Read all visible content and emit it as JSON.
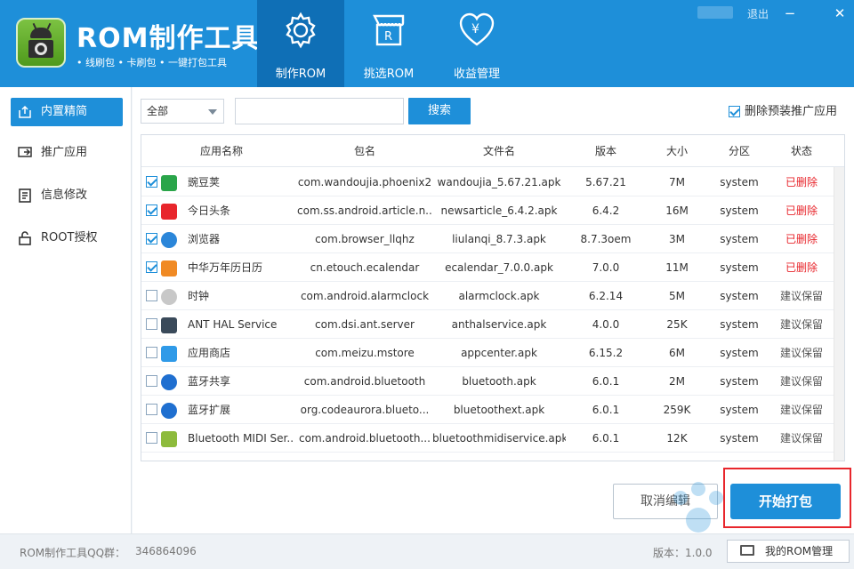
{
  "app": {
    "title": "ROM制作工具",
    "subtitle": "• 线刷包   • 卡刷包   • 一键打包工具",
    "logout": "退出"
  },
  "nav": {
    "tabs": [
      {
        "label": "制作ROM",
        "icon": "gear-icon"
      },
      {
        "label": "挑选ROM",
        "icon": "store-icon"
      },
      {
        "label": "收益管理",
        "icon": "heart-yen-icon"
      }
    ]
  },
  "sidebar": {
    "items": [
      {
        "label": "内置精简",
        "icon": "export-icon"
      },
      {
        "label": "推广应用",
        "icon": "install-icon"
      },
      {
        "label": "信息修改",
        "icon": "document-icon"
      },
      {
        "label": "ROOT授权",
        "icon": "lock-icon"
      }
    ]
  },
  "filter": {
    "select_value": "全部",
    "search_placeholder": "",
    "search_button": "搜索",
    "delete_preinstalled_label": "删除预装推广应用",
    "delete_preinstalled_checked": true
  },
  "table": {
    "columns": [
      "应用名称",
      "包名",
      "文件名",
      "版本",
      "大小",
      "分区",
      "状态"
    ],
    "rows": [
      {
        "checked": true,
        "icon": "wandoujia-icon",
        "name": "豌豆荚",
        "package": "com.wandoujia.phoenix2",
        "file": "wandoujia_5.67.21.apk",
        "version": "5.67.21",
        "size": "7M",
        "partition": "system",
        "status": "已删除"
      },
      {
        "checked": true,
        "icon": "toutiao-icon",
        "name": "今日头条",
        "package": "com.ss.android.article.n...",
        "file": "newsarticle_6.4.2.apk",
        "version": "6.4.2",
        "size": "16M",
        "partition": "system",
        "status": "已删除"
      },
      {
        "checked": true,
        "icon": "browser-icon",
        "name": "浏览器",
        "package": "com.browser_llqhz",
        "file": "liulanqi_8.7.3.apk",
        "version": "8.7.3oem",
        "size": "3M",
        "partition": "system",
        "status": "已删除"
      },
      {
        "checked": true,
        "icon": "calendar-icon",
        "name": "中华万年历日历",
        "package": "cn.etouch.ecalendar",
        "file": "ecalendar_7.0.0.apk",
        "version": "7.0.0",
        "size": "11M",
        "partition": "system",
        "status": "已删除"
      },
      {
        "checked": false,
        "icon": "clock-icon",
        "name": "时钟",
        "package": "com.android.alarmclock",
        "file": "alarmclock.apk",
        "version": "6.2.14",
        "size": "5M",
        "partition": "system",
        "status": "建议保留"
      },
      {
        "checked": false,
        "icon": "ant-hal-icon",
        "name": "ANT HAL Service",
        "package": "com.dsi.ant.server",
        "file": "anthalservice.apk",
        "version": "4.0.0",
        "size": "25K",
        "partition": "system",
        "status": "建议保留"
      },
      {
        "checked": false,
        "icon": "app-store-icon",
        "name": "应用商店",
        "package": "com.meizu.mstore",
        "file": "appcenter.apk",
        "version": "6.15.2",
        "size": "6M",
        "partition": "system",
        "status": "建议保留"
      },
      {
        "checked": false,
        "icon": "bluetooth-icon",
        "name": "蓝牙共享",
        "package": "com.android.bluetooth",
        "file": "bluetooth.apk",
        "version": "6.0.1",
        "size": "2M",
        "partition": "system",
        "status": "建议保留"
      },
      {
        "checked": false,
        "icon": "bluetooth-icon",
        "name": "蓝牙扩展",
        "package": "org.codeaurora.blueto...",
        "file": "bluetoothext.apk",
        "version": "6.0.1",
        "size": "259K",
        "partition": "system",
        "status": "建议保留"
      },
      {
        "checked": false,
        "icon": "android-icon",
        "name": "Bluetooth MIDI Ser...",
        "package": "com.android.bluetooth...",
        "file": "bluetoothmidiservice.apk",
        "version": "6.0.1",
        "size": "12K",
        "partition": "system",
        "status": "建议保留"
      }
    ]
  },
  "actions": {
    "cancel": "取消编辑",
    "start": "开始打包"
  },
  "statusbar": {
    "qq_label": "ROM制作工具QQ群：",
    "qq_number": "346864096",
    "version": "版本：1.0.0",
    "my_rom": "我的ROM管理"
  },
  "colors": {
    "primary": "#1e8fd9",
    "active_tab": "#0f6fb6",
    "deleted": "#e8262c"
  }
}
